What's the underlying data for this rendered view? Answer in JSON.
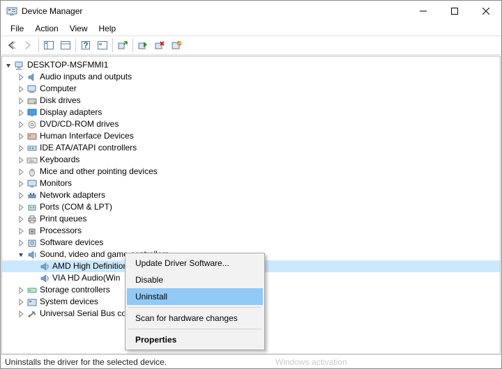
{
  "window": {
    "title": "Device Manager"
  },
  "menubar": {
    "file": "File",
    "action": "Action",
    "view": "View",
    "help": "Help"
  },
  "tree": {
    "root": "DESKTOP-MSFMMI1",
    "items": [
      "Audio inputs and outputs",
      "Computer",
      "Disk drives",
      "Display adapters",
      "DVD/CD-ROM drives",
      "Human Interface Devices",
      "IDE ATA/ATAPI controllers",
      "Keyboards",
      "Mice and other pointing devices",
      "Monitors",
      "Network adapters",
      "Ports (COM & LPT)",
      "Print queues",
      "Processors",
      "Software devices"
    ],
    "sound_category": "Sound, video and game controllers",
    "sound_children": {
      "amd": "AMD High Definition Audio Device",
      "via": "VIA HD Audio(Win"
    },
    "items_after": [
      "Storage controllers",
      "System devices",
      "Universal Serial Bus co"
    ]
  },
  "context_menu": {
    "update": "Update Driver Software...",
    "disable": "Disable",
    "uninstall": "Uninstall",
    "scan": "Scan for hardware changes",
    "properties": "Properties"
  },
  "statusbar": {
    "text": "Uninstalls the driver for the selected device.",
    "ghost": "Windows activation"
  }
}
